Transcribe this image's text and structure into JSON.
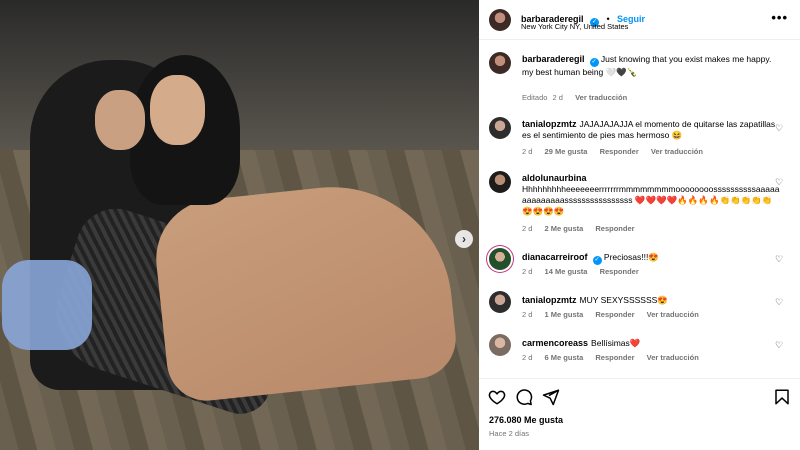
{
  "post": {
    "username": "barbaraderegil",
    "follow_label": "Seguir",
    "separator": "•",
    "location": "New York City NY, United States",
    "more_label": "•••",
    "next_label": "›"
  },
  "caption": {
    "username": "barbaraderegil",
    "text_line1": "Just knowing that you exist makes me happy.",
    "text_line2": "my best human being 🤍🖤🍾",
    "edited": "Editado",
    "time": "2 d",
    "translate": "Ver traducción"
  },
  "comments": [
    {
      "username": "tanialopzmtz",
      "text": "JAJAJAJAJJA el momento de quitarse las zapatillas es el sentimiento de pies mas hermoso 😆",
      "time": "2 d",
      "likes": "29 Me gusta",
      "reply": "Responder",
      "translate": "Ver traducción"
    },
    {
      "username": "aldolunaurbina",
      "text": "Hhhhhhhhheeeeeeerrrrrrrmmmmmmmmoooooooossssssssssaaaaaaaaaaaaaassssssssssssssss ❤️❤️❤️❤️🔥🔥🔥🔥👏👏👏👏👏😍😍😍😍",
      "time": "2 d",
      "likes": "2 Me gusta",
      "reply": "Responder"
    },
    {
      "username": "dianacarreiroof",
      "text": "Preciosas!!!😍",
      "time": "2 d",
      "likes": "14 Me gusta",
      "reply": "Responder"
    },
    {
      "username": "tanialopzmtz",
      "text": "MUY SEXYSSSSSS😍",
      "time": "2 d",
      "likes": "1 Me gusta",
      "reply": "Responder",
      "translate": "Ver traducción"
    },
    {
      "username": "carmencoreass",
      "text": "Bellísimas❤️",
      "time": "2 d",
      "likes": "6 Me gusta",
      "reply": "Responder",
      "translate": "Ver traducción"
    }
  ],
  "actions": {
    "likes": "276.080 Me gusta",
    "time": "Hace 2 días"
  },
  "icons": [
    "heart-icon",
    "comment-icon",
    "share-icon",
    "bookmark-icon",
    "verified-badge-icon",
    "more-options-icon",
    "chevron-right-icon"
  ],
  "colors": {
    "link": "#0095f6",
    "muted": "#737373",
    "border": "#efefef"
  }
}
